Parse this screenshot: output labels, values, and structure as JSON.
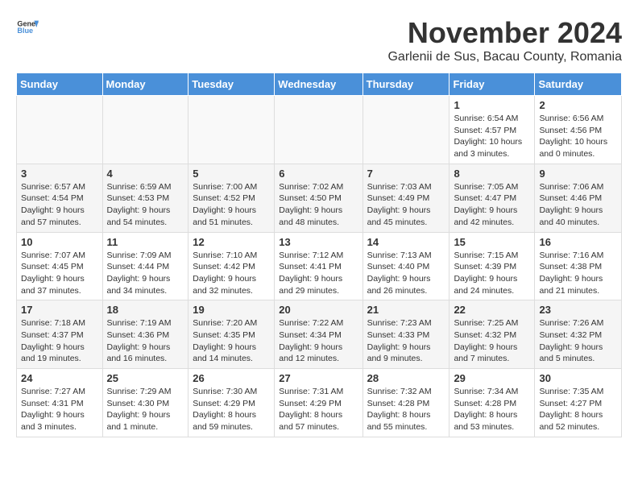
{
  "header": {
    "logo_general": "General",
    "logo_blue": "Blue",
    "title": "November 2024",
    "subtitle": "Garlenii de Sus, Bacau County, Romania"
  },
  "days_of_week": [
    "Sunday",
    "Monday",
    "Tuesday",
    "Wednesday",
    "Thursday",
    "Friday",
    "Saturday"
  ],
  "weeks": [
    [
      {
        "day": "",
        "info": ""
      },
      {
        "day": "",
        "info": ""
      },
      {
        "day": "",
        "info": ""
      },
      {
        "day": "",
        "info": ""
      },
      {
        "day": "",
        "info": ""
      },
      {
        "day": "1",
        "info": "Sunrise: 6:54 AM\nSunset: 4:57 PM\nDaylight: 10 hours and 3 minutes."
      },
      {
        "day": "2",
        "info": "Sunrise: 6:56 AM\nSunset: 4:56 PM\nDaylight: 10 hours and 0 minutes."
      }
    ],
    [
      {
        "day": "3",
        "info": "Sunrise: 6:57 AM\nSunset: 4:54 PM\nDaylight: 9 hours and 57 minutes."
      },
      {
        "day": "4",
        "info": "Sunrise: 6:59 AM\nSunset: 4:53 PM\nDaylight: 9 hours and 54 minutes."
      },
      {
        "day": "5",
        "info": "Sunrise: 7:00 AM\nSunset: 4:52 PM\nDaylight: 9 hours and 51 minutes."
      },
      {
        "day": "6",
        "info": "Sunrise: 7:02 AM\nSunset: 4:50 PM\nDaylight: 9 hours and 48 minutes."
      },
      {
        "day": "7",
        "info": "Sunrise: 7:03 AM\nSunset: 4:49 PM\nDaylight: 9 hours and 45 minutes."
      },
      {
        "day": "8",
        "info": "Sunrise: 7:05 AM\nSunset: 4:47 PM\nDaylight: 9 hours and 42 minutes."
      },
      {
        "day": "9",
        "info": "Sunrise: 7:06 AM\nSunset: 4:46 PM\nDaylight: 9 hours and 40 minutes."
      }
    ],
    [
      {
        "day": "10",
        "info": "Sunrise: 7:07 AM\nSunset: 4:45 PM\nDaylight: 9 hours and 37 minutes."
      },
      {
        "day": "11",
        "info": "Sunrise: 7:09 AM\nSunset: 4:44 PM\nDaylight: 9 hours and 34 minutes."
      },
      {
        "day": "12",
        "info": "Sunrise: 7:10 AM\nSunset: 4:42 PM\nDaylight: 9 hours and 32 minutes."
      },
      {
        "day": "13",
        "info": "Sunrise: 7:12 AM\nSunset: 4:41 PM\nDaylight: 9 hours and 29 minutes."
      },
      {
        "day": "14",
        "info": "Sunrise: 7:13 AM\nSunset: 4:40 PM\nDaylight: 9 hours and 26 minutes."
      },
      {
        "day": "15",
        "info": "Sunrise: 7:15 AM\nSunset: 4:39 PM\nDaylight: 9 hours and 24 minutes."
      },
      {
        "day": "16",
        "info": "Sunrise: 7:16 AM\nSunset: 4:38 PM\nDaylight: 9 hours and 21 minutes."
      }
    ],
    [
      {
        "day": "17",
        "info": "Sunrise: 7:18 AM\nSunset: 4:37 PM\nDaylight: 9 hours and 19 minutes."
      },
      {
        "day": "18",
        "info": "Sunrise: 7:19 AM\nSunset: 4:36 PM\nDaylight: 9 hours and 16 minutes."
      },
      {
        "day": "19",
        "info": "Sunrise: 7:20 AM\nSunset: 4:35 PM\nDaylight: 9 hours and 14 minutes."
      },
      {
        "day": "20",
        "info": "Sunrise: 7:22 AM\nSunset: 4:34 PM\nDaylight: 9 hours and 12 minutes."
      },
      {
        "day": "21",
        "info": "Sunrise: 7:23 AM\nSunset: 4:33 PM\nDaylight: 9 hours and 9 minutes."
      },
      {
        "day": "22",
        "info": "Sunrise: 7:25 AM\nSunset: 4:32 PM\nDaylight: 9 hours and 7 minutes."
      },
      {
        "day": "23",
        "info": "Sunrise: 7:26 AM\nSunset: 4:32 PM\nDaylight: 9 hours and 5 minutes."
      }
    ],
    [
      {
        "day": "24",
        "info": "Sunrise: 7:27 AM\nSunset: 4:31 PM\nDaylight: 9 hours and 3 minutes."
      },
      {
        "day": "25",
        "info": "Sunrise: 7:29 AM\nSunset: 4:30 PM\nDaylight: 9 hours and 1 minute."
      },
      {
        "day": "26",
        "info": "Sunrise: 7:30 AM\nSunset: 4:29 PM\nDaylight: 8 hours and 59 minutes."
      },
      {
        "day": "27",
        "info": "Sunrise: 7:31 AM\nSunset: 4:29 PM\nDaylight: 8 hours and 57 minutes."
      },
      {
        "day": "28",
        "info": "Sunrise: 7:32 AM\nSunset: 4:28 PM\nDaylight: 8 hours and 55 minutes."
      },
      {
        "day": "29",
        "info": "Sunrise: 7:34 AM\nSunset: 4:28 PM\nDaylight: 8 hours and 53 minutes."
      },
      {
        "day": "30",
        "info": "Sunrise: 7:35 AM\nSunset: 4:27 PM\nDaylight: 8 hours and 52 minutes."
      }
    ]
  ]
}
